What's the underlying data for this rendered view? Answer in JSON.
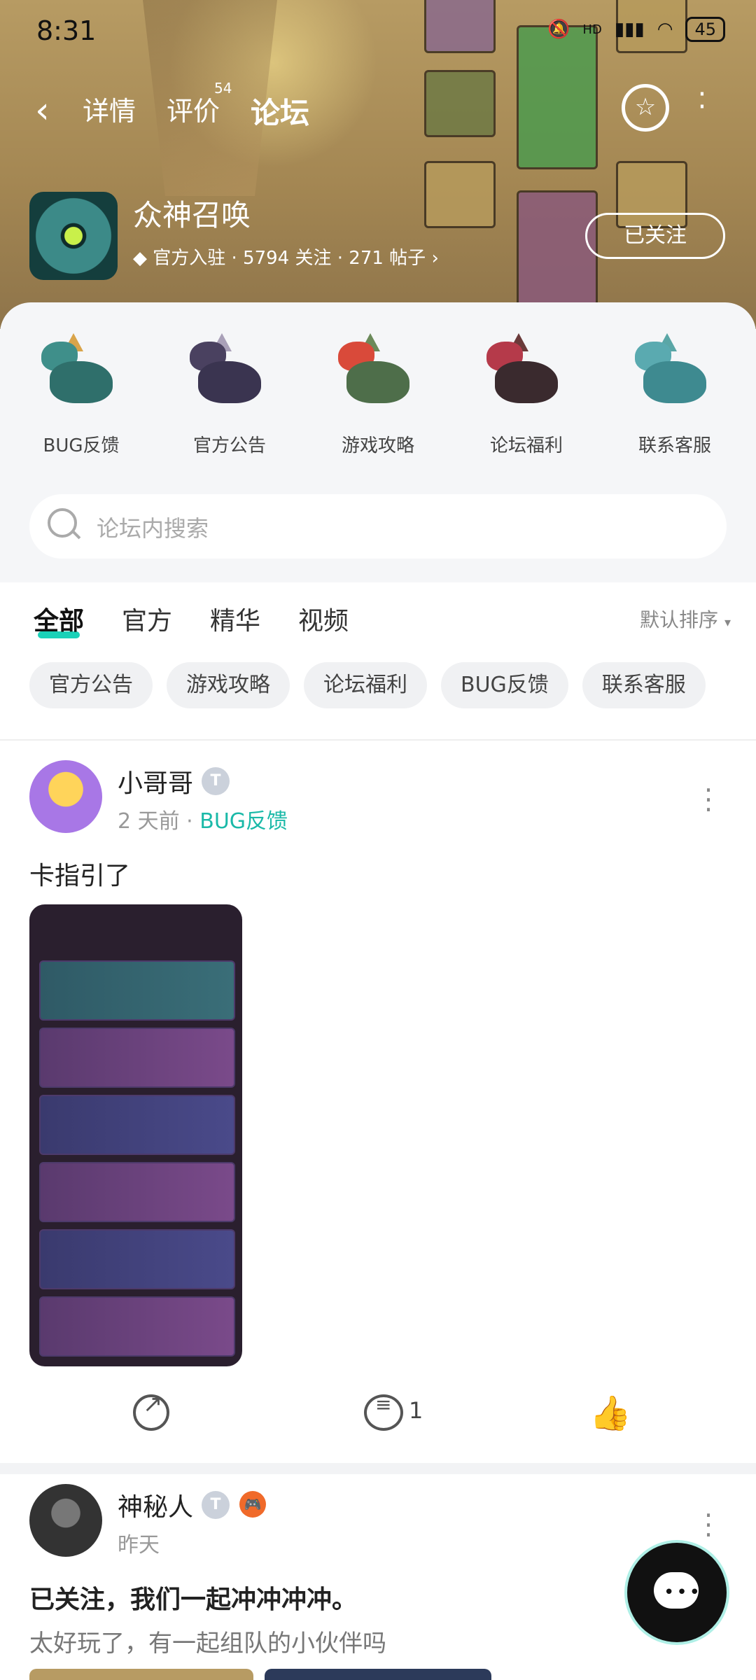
{
  "status_bar": {
    "time": "8:31",
    "net_label": "HD",
    "battery": "45"
  },
  "nav": {
    "tabs": [
      {
        "label": "详情"
      },
      {
        "label": "评价",
        "superscript": "54"
      },
      {
        "label": "论坛",
        "active": true
      }
    ]
  },
  "game": {
    "name": "众神召唤",
    "meta": "官方入驻 · 5794 关注 · 271 帖子",
    "follow_label": "已关注"
  },
  "categories": [
    {
      "label": "BUG反馈"
    },
    {
      "label": "官方公告"
    },
    {
      "label": "游戏攻略"
    },
    {
      "label": "论坛福利"
    },
    {
      "label": "联系客服"
    }
  ],
  "search": {
    "placeholder": "论坛内搜索"
  },
  "feed_tabs": [
    {
      "label": "全部",
      "active": true
    },
    {
      "label": "官方"
    },
    {
      "label": "精华"
    },
    {
      "label": "视频"
    }
  ],
  "sort_label": "默认排序",
  "chips": [
    "官方公告",
    "游戏攻略",
    "论坛福利",
    "BUG反馈",
    "联系客服"
  ],
  "posts": [
    {
      "user": "小哥哥",
      "level": "T",
      "time": "2 天前",
      "tag": "BUG反馈",
      "text": "卡指引了",
      "comments": "1"
    },
    {
      "user": "神秘人",
      "level": "T",
      "time": "昨天",
      "text": "已关注，我们一起冲冲冲冲。",
      "subtext": "太好玩了，有一起组队的小伙伴吗"
    }
  ],
  "colors": {
    "accent": "#1ad1b8",
    "tag": "#1ab9a8",
    "banner": "#a48753"
  }
}
